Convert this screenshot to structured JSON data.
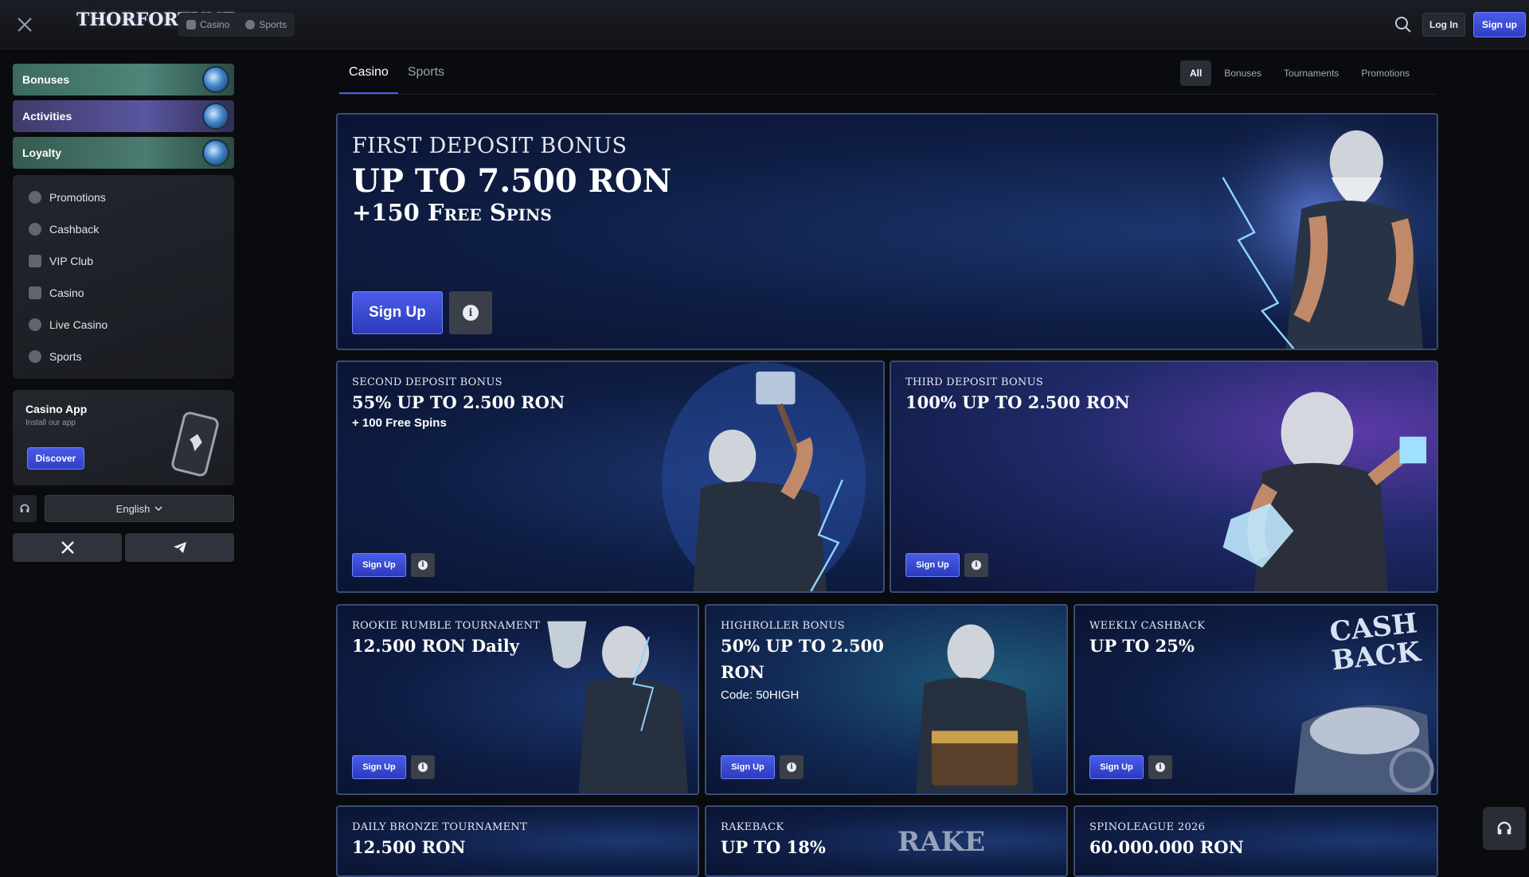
{
  "header": {
    "logo": "THORFORTUNE",
    "tabs": [
      {
        "label": "Casino",
        "icon": "casino-icon"
      },
      {
        "label": "Sports",
        "icon": "sports-icon"
      }
    ],
    "login_label": "Log In",
    "signup_label": "Sign up"
  },
  "sidebar": {
    "big_items": [
      {
        "label": "Bonuses",
        "icon": "bonuses-badge-icon"
      },
      {
        "label": "Activities",
        "icon": "activities-badge-icon"
      },
      {
        "label": "Loyalty",
        "icon": "loyalty-badge-icon"
      }
    ],
    "nav": [
      {
        "label": "Promotions",
        "icon": "promotions-icon"
      },
      {
        "label": "Cashback",
        "icon": "cashback-icon"
      },
      {
        "label": "VIP Club",
        "icon": "crown-icon"
      },
      {
        "label": "Casino",
        "icon": "casino-icon"
      },
      {
        "label": "Live Casino",
        "icon": "live-casino-icon"
      },
      {
        "label": "Sports",
        "icon": "sports-icon"
      }
    ],
    "app": {
      "title": "Casino App",
      "subtitle": "Install our app",
      "button": "Discover"
    },
    "language": "English"
  },
  "main": {
    "tabs": [
      "Casino",
      "Sports"
    ],
    "active_tab": "Casino",
    "filters": [
      "All",
      "Bonuses",
      "Tournaments",
      "Promotions"
    ],
    "active_filter": "All"
  },
  "cards": {
    "hero": {
      "label": "First Deposit Bonus",
      "title": "UP TO 7.500 RON",
      "sub": "+150 Free Spins",
      "button": "Sign Up"
    },
    "second": {
      "label": "SECOND DEPOSIT BONUS",
      "title": "55% UP TO 2.500 RON",
      "sub": "+ 100 Free Spins",
      "button": "Sign Up"
    },
    "third": {
      "label": "THIRD DEPOSIT BONUS",
      "title": "100% UP TO 2.500 RON",
      "button": "Sign Up"
    },
    "rookie": {
      "label": "ROOKIE RUMBLE TOURNAMENT",
      "title": "12.500 RON Daily",
      "button": "Sign Up"
    },
    "highroller": {
      "label": "HIGHROLLER BONUS",
      "title": "50% UP TO 2.500",
      "title2": "RON",
      "sub": "Code: 50HIGH",
      "button": "Sign Up"
    },
    "cashback": {
      "label": "WEEKLY CASHBACK",
      "title": "UP TO 25%",
      "art_text1": "CASH",
      "art_text2": "BACK",
      "button": "Sign Up"
    },
    "bronze": {
      "label": "DAILY BRONZE TOURNAMENT",
      "title": "12.500 RON"
    },
    "rakeback": {
      "label": "RAKEBACK",
      "title": "UP TO 18%",
      "art_text": "RAKE"
    },
    "spinoleague": {
      "label": "SPINOLEAGUE 2026",
      "title": "60.000.000 RON"
    }
  },
  "colors": {
    "accent": "#4a5ce8",
    "card_bg": "#0f1e45",
    "card_border": "#3a4c78"
  }
}
